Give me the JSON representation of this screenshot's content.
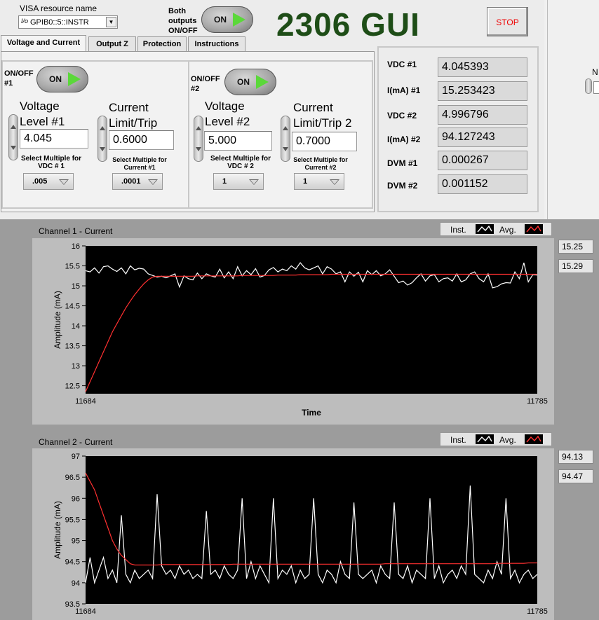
{
  "header": {
    "visa_label": "VISA resource name",
    "visa_value": "GPIB0::5::INSTR",
    "both_outputs_label": "Both outputs ON/OFF",
    "both_outputs_state": "ON",
    "app_title": "2306 GUI",
    "stop_label": "STOP"
  },
  "tabs": [
    {
      "label": "Voltage and Current",
      "active": true
    },
    {
      "label": "Output Z",
      "active": false
    },
    {
      "label": "Protection",
      "active": false
    },
    {
      "label": "Instructions",
      "active": false
    }
  ],
  "ch1": {
    "onoff_label": "ON/OFF #1",
    "onoff_state": "ON",
    "voltage_label": "Voltage Level #1",
    "voltage_value": "4.045",
    "current_label": "Current Limit/Trip",
    "current_value": "0.6000",
    "volt_mult_label": "Select Multiple for VDC # 1",
    "volt_mult_value": ".005",
    "curr_mult_label": "Select Multiple for Current #1",
    "curr_mult_value": ".0001"
  },
  "ch2": {
    "onoff_label": "ON/OFF #2",
    "onoff_state": "ON",
    "voltage_label": "Voltage Level #2",
    "voltage_value": "5.000",
    "current_label": "Current Limit/Trip 2",
    "current_value": "0.7000",
    "volt_mult_label": "Select Multiple for VDC # 2",
    "volt_mult_value": "1",
    "curr_mult_label": "Select Multiple for Current #2",
    "curr_mult_value": "1"
  },
  "readouts": [
    {
      "label": "VDC #1",
      "value": "4.045393"
    },
    {
      "label": "I(mA) #1",
      "value": "15.253423"
    },
    {
      "label": "VDC #2",
      "value": "4.996796"
    },
    {
      "label": "I(mA) #2",
      "value": "94.127243"
    },
    {
      "label": "DVM #1",
      "value": "0.000267"
    },
    {
      "label": "DVM #2",
      "value": "0.001152"
    }
  ],
  "right_strip_label": "N",
  "legend": {
    "inst": "Inst.",
    "avg": "Avg."
  },
  "colors": {
    "inst": "#ffffff",
    "avg": "#ff3030",
    "plot_bg": "#000000",
    "title_green": "#1e4d17"
  },
  "chart_data": [
    {
      "type": "line",
      "title": "Channel 1 - Current",
      "xlabel": "Time",
      "ylabel": "Amplitude (mA)",
      "xlim": [
        11684,
        11785
      ],
      "ylim": [
        12.3,
        16
      ],
      "yticks": [
        16,
        15.5,
        15,
        14.5,
        14,
        13.5,
        13,
        12.5
      ],
      "xtick_labels": [
        "11684",
        "11785"
      ],
      "inst_readout": "15.25",
      "avg_readout": "15.29",
      "series": [
        {
          "name": "Inst.",
          "values": [
            15.38,
            15.35,
            15.45,
            15.32,
            15.48,
            15.5,
            15.42,
            15.36,
            15.45,
            15.3,
            15.5,
            15.4,
            15.44,
            15.42,
            15.3,
            15.26,
            15.22,
            15.24,
            15.2,
            15.25,
            15.3,
            14.97,
            15.25,
            15.18,
            15.15,
            15.32,
            15.18,
            15.3,
            15.25,
            15.22,
            15.42,
            15.2,
            15.35,
            15.18,
            15.48,
            15.25,
            15.38,
            15.28,
            15.43,
            15.22,
            15.26,
            15.4,
            15.46,
            15.35,
            15.42,
            15.38,
            15.5,
            15.42,
            15.58,
            15.45,
            15.4,
            15.45,
            15.5,
            15.3,
            15.48,
            15.42,
            15.3,
            15.35,
            15.1,
            15.35,
            15.24,
            15.34,
            15.1,
            15.38,
            15.28,
            15.38,
            15.25,
            15.3,
            15.4,
            15.24,
            15.08,
            15.12,
            15.02,
            15.08,
            15.2,
            15.3,
            15.12,
            15.25,
            15.28,
            15.1,
            15.18,
            15.2,
            15.12,
            15.3,
            15.1,
            15.15,
            15.3,
            15.35,
            15.18,
            15.1,
            15.3,
            14.95,
            14.98,
            15.05,
            15.08,
            15.07,
            15.35,
            15.18,
            15.58,
            15.1,
            15.28,
            15.27
          ]
        },
        {
          "name": "Avg.",
          "values": [
            12.35,
            12.6,
            12.85,
            13.1,
            13.35,
            13.6,
            13.85,
            14.05,
            14.25,
            14.45,
            14.62,
            14.78,
            14.92,
            15.05,
            15.15,
            15.22,
            15.24,
            15.24,
            15.24,
            15.24,
            15.24,
            15.24,
            15.24,
            15.24,
            15.24,
            15.25,
            15.25,
            15.25,
            15.25,
            15.25,
            15.25,
            15.25,
            15.25,
            15.25,
            15.25,
            15.26,
            15.26,
            15.26,
            15.26,
            15.26,
            15.26,
            15.26,
            15.26,
            15.27,
            15.27,
            15.27,
            15.27,
            15.27,
            15.28,
            15.28,
            15.28,
            15.28,
            15.28,
            15.28,
            15.28,
            15.29,
            15.29,
            15.29,
            15.29,
            15.29,
            15.29,
            15.29,
            15.29,
            15.29,
            15.29,
            15.29,
            15.29,
            15.29,
            15.29,
            15.29,
            15.29,
            15.29,
            15.29,
            15.29,
            15.29,
            15.29,
            15.29,
            15.29,
            15.29,
            15.29,
            15.29,
            15.29,
            15.29,
            15.29,
            15.29,
            15.29,
            15.29,
            15.29,
            15.29,
            15.29,
            15.29,
            15.29,
            15.29,
            15.29,
            15.29,
            15.29,
            15.29,
            15.29,
            15.29,
            15.29,
            15.29,
            15.29
          ]
        }
      ]
    },
    {
      "type": "line",
      "title": "Channel 2 - Current",
      "xlabel": "",
      "ylabel": "Amplitude (mA)",
      "xlim": [
        11684,
        11785
      ],
      "ylim": [
        93.5,
        97
      ],
      "yticks": [
        97,
        96.5,
        96,
        95.5,
        95,
        94.5,
        94,
        93.5
      ],
      "xtick_labels": [
        "11684",
        "11785"
      ],
      "inst_readout": "94.13",
      "avg_readout": "94.47",
      "series": [
        {
          "name": "Inst.",
          "values": [
            94.0,
            94.6,
            94.0,
            94.3,
            94.6,
            94.1,
            94.3,
            94.0,
            95.6,
            94.2,
            94.0,
            94.3,
            94.1,
            94.2,
            94.3,
            94.1,
            96.1,
            94.4,
            94.2,
            94.3,
            94.1,
            94.4,
            94.2,
            94.3,
            94.1,
            94.2,
            94.1,
            95.7,
            94.2,
            94.3,
            94.1,
            94.4,
            94.2,
            94.1,
            94.3,
            96.0,
            94.1,
            94.5,
            94.1,
            94.4,
            94.2,
            94.0,
            96.0,
            94.1,
            94.3,
            94.2,
            94.4,
            94.0,
            94.3,
            94.1,
            94.2,
            96.0,
            94.2,
            94.0,
            94.3,
            94.2,
            94.0,
            94.5,
            94.2,
            94.1,
            95.9,
            94.2,
            94.1,
            94.2,
            94.3,
            94.0,
            94.4,
            94.2,
            94.1,
            95.9,
            94.2,
            94.1,
            94.4,
            94.0,
            94.3,
            94.2,
            94.1,
            96.0,
            94.1,
            94.4,
            94.0,
            94.2,
            94.3,
            94.1,
            94.4,
            94.2,
            96.3,
            94.2,
            94.1,
            94.0,
            94.3,
            94.1,
            94.5,
            94.2,
            96.0,
            94.1,
            94.3,
            94.0,
            94.2,
            94.3,
            94.1,
            94.2
          ]
        },
        {
          "name": "Avg.",
          "values": [
            96.6,
            96.4,
            96.2,
            95.9,
            95.6,
            95.3,
            95.0,
            94.8,
            94.65,
            94.55,
            94.45,
            94.42,
            94.42,
            94.42,
            94.42,
            94.42,
            94.42,
            94.43,
            94.43,
            94.43,
            94.43,
            94.43,
            94.43,
            94.43,
            94.43,
            94.43,
            94.43,
            94.43,
            94.43,
            94.43,
            94.43,
            94.43,
            94.43,
            94.44,
            94.44,
            94.44,
            94.44,
            94.44,
            94.44,
            94.44,
            94.44,
            94.44,
            94.44,
            94.44,
            94.44,
            94.44,
            94.44,
            94.44,
            94.44,
            94.44,
            94.44,
            94.44,
            94.44,
            94.44,
            94.44,
            94.44,
            94.44,
            94.44,
            94.44,
            94.44,
            94.44,
            94.44,
            94.44,
            94.44,
            94.44,
            94.44,
            94.44,
            94.45,
            94.45,
            94.45,
            94.45,
            94.45,
            94.45,
            94.45,
            94.45,
            94.45,
            94.45,
            94.45,
            94.45,
            94.45,
            94.45,
            94.45,
            94.45,
            94.45,
            94.45,
            94.45,
            94.45,
            94.45,
            94.45,
            94.45,
            94.45,
            94.45,
            94.46,
            94.46,
            94.46,
            94.46,
            94.46,
            94.46,
            94.46,
            94.47,
            94.47,
            94.47
          ]
        }
      ]
    }
  ]
}
